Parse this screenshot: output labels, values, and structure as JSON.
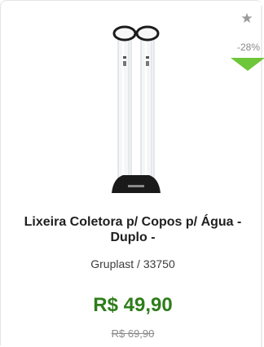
{
  "product": {
    "favorite_icon": "star-icon",
    "discount": "-28%",
    "discount_indicator_color": "#6ec63b",
    "name": "Lixeira Coletora p/ Copos p/ Água - Duplo -",
    "brand_sku": "Gruplast / 33750",
    "price": "R$ 49,90",
    "old_price": "R$ 69,90",
    "price_color": "#2e7d1a"
  }
}
